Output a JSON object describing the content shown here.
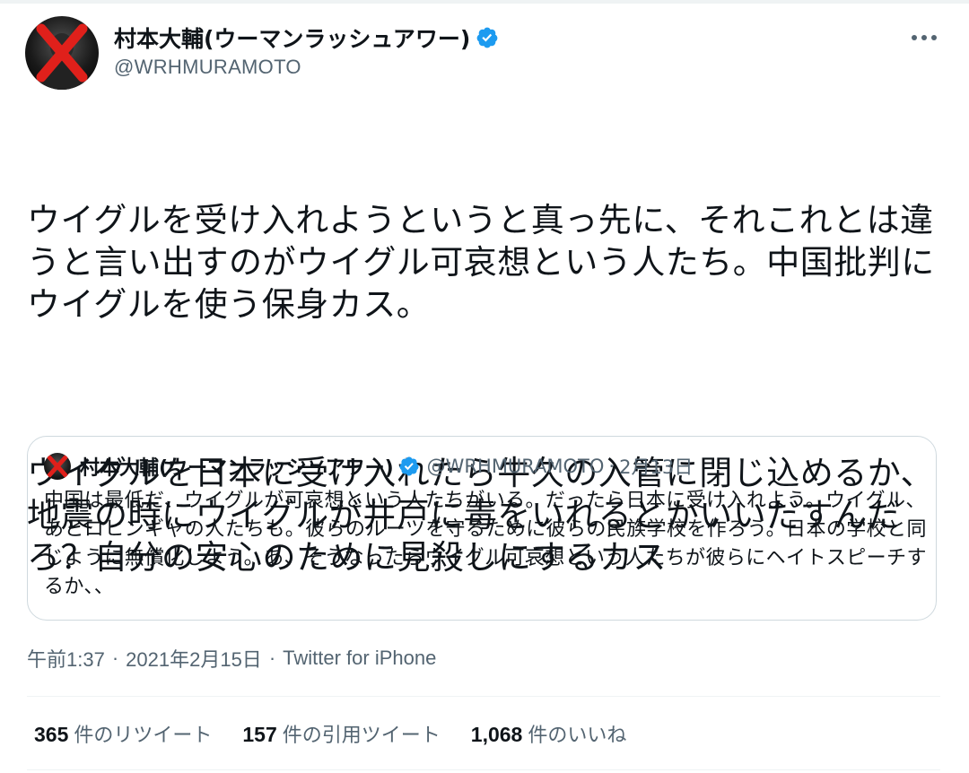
{
  "tweet": {
    "author": {
      "display_name": "村本大輔(ウーマンラッシュアワー)",
      "handle": "@WRHMURAMOTO",
      "verified_icon": "verified-badge-icon",
      "avatar_icon": "avatar-red-x-icon"
    },
    "more_icon": "more-dots-icon",
    "paragraphs": [
      "ウイグルを受け入れようというと真っ先に、それこれとは違うと言い出すのがウイグル可哀想という人たち。中国批判にウイグルを使う保身カス。",
      "ウイグルを日本に受け入れたら牛久の入管に閉じ込めるか、地震の時にウイグルが井戸に毒をいれるとかいいだすんだろ？自分の安心のために見殺しにするカス"
    ],
    "quote": {
      "display_name": "村本大輔(ウーマンラッシュアワー)",
      "handle": "@WRHMURAMOTO",
      "separator": "·",
      "date": "2月13日",
      "text": "中国は最低だ、ウイグルが可哀想という人たちがいる。だったら日本に受け入れよう。ウイグル、あとロヒンギャの人たちも。彼らのルーツを守るために彼らの民族学校を作ろう。日本の学校と同じように無償化しよう。あ、そうなったらウイグル可哀想という人たちが彼らにヘイトスピーチするか、、"
    },
    "meta": {
      "time": "午前1:37",
      "separator": "·",
      "date": "2021年2月15日",
      "source": "Twitter for iPhone"
    },
    "stats": {
      "retweets_count": "365",
      "retweets_label": "件のリツイート",
      "quotes_count": "157",
      "quotes_label": "件の引用ツイート",
      "likes_count": "1,068",
      "likes_label": "件のいいね"
    }
  },
  "colors": {
    "verified_blue": "#1d9bf0",
    "secondary_text": "#536471",
    "primary_text": "#0f1419",
    "border": "#cfd9de",
    "divider": "#eff3f4",
    "avatar_x_red": "#e0201b"
  }
}
